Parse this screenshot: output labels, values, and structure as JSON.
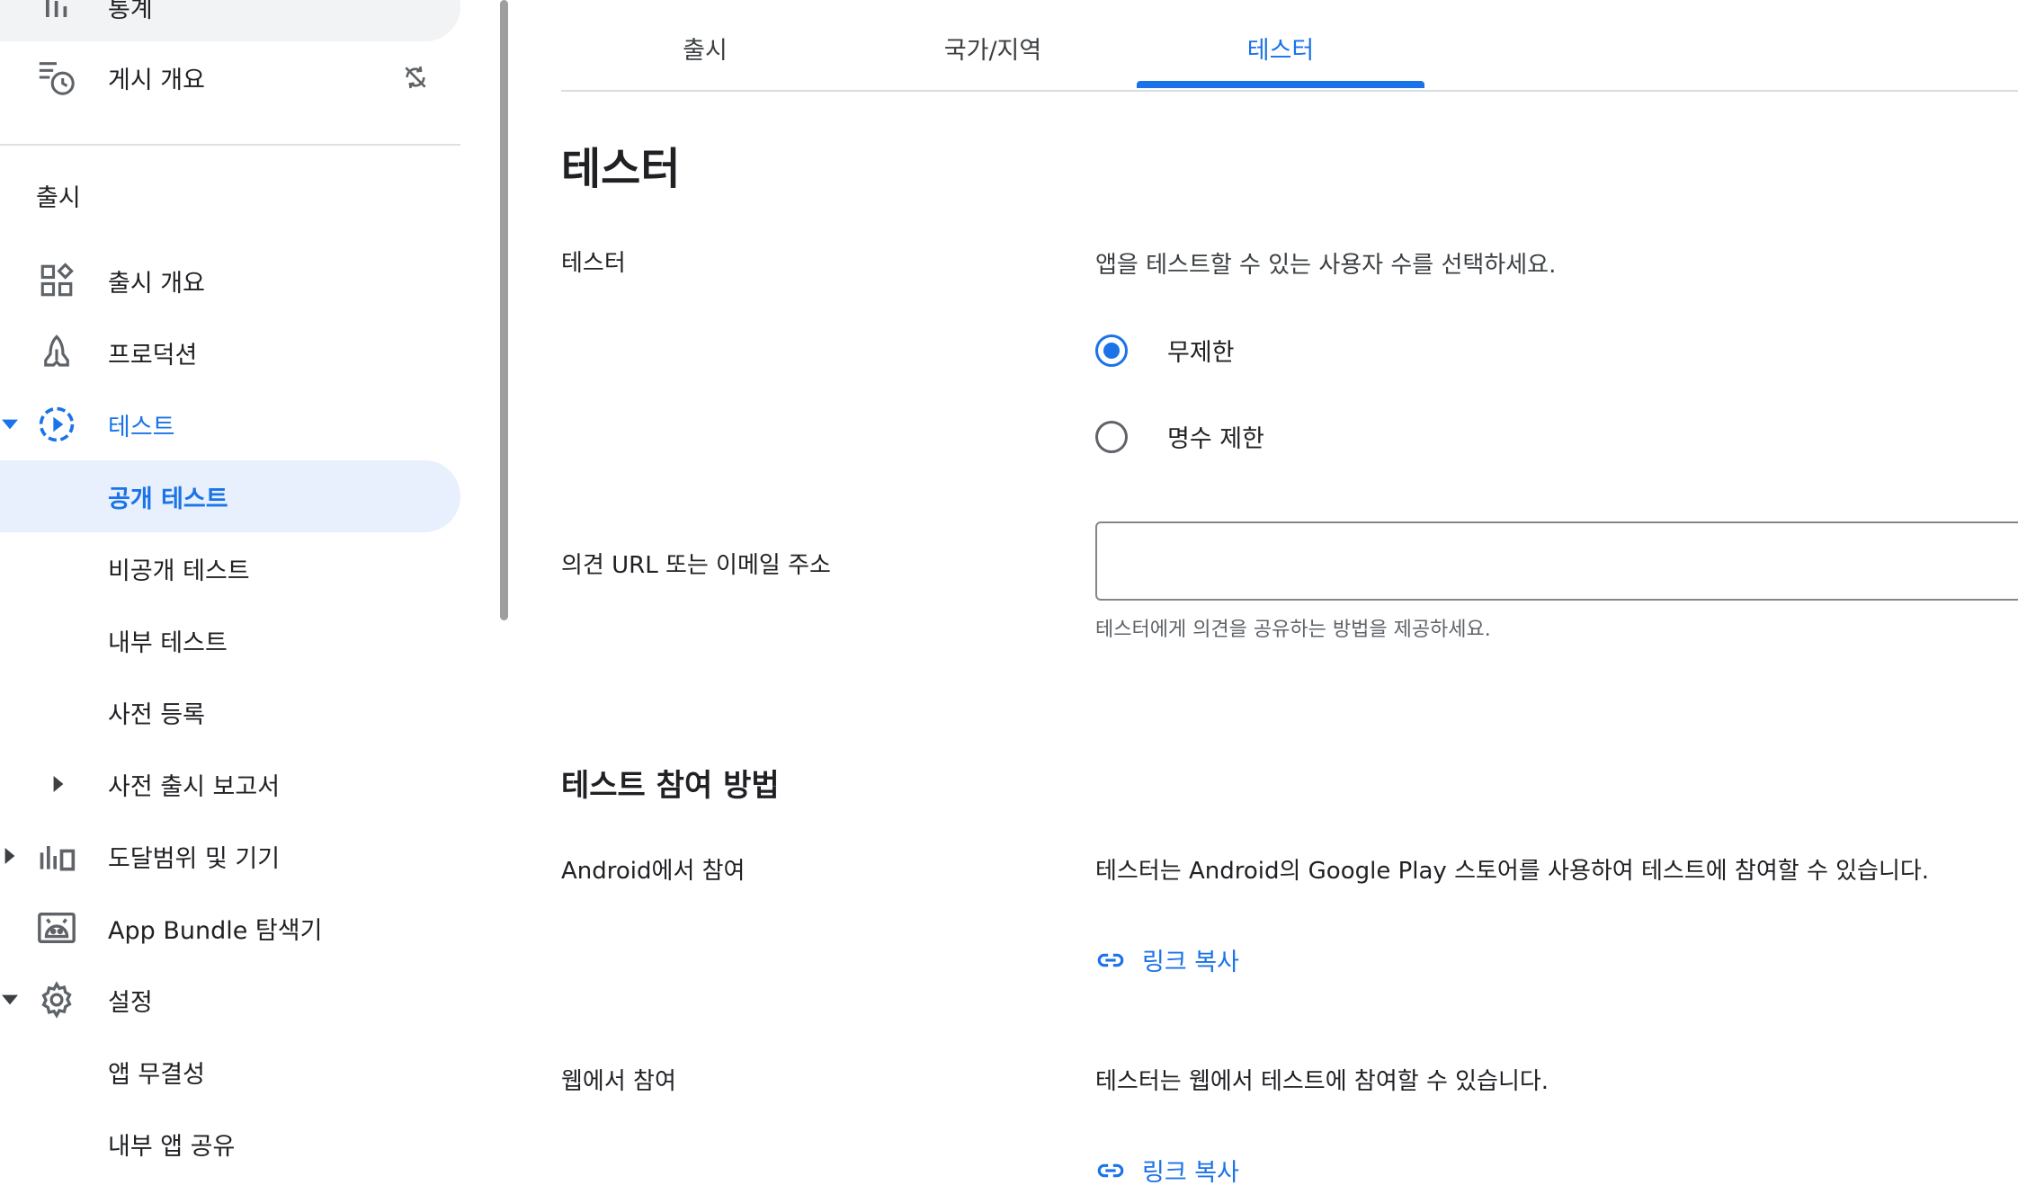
{
  "sidebar": {
    "top_items": [
      {
        "label": "통계",
        "icon": "bar-chart-icon"
      },
      {
        "label": "게시 개요",
        "icon": "publishing-overview-icon",
        "badge_icon": "sync-disabled-icon"
      }
    ],
    "section_heading": "출시",
    "items": [
      {
        "label": "출시 개요",
        "icon": "dashboard-icon"
      },
      {
        "label": "프로덕션",
        "icon": "production-icon"
      },
      {
        "label": "테스트",
        "icon": "testing-play-icon"
      },
      {
        "label": "공개 테스트"
      },
      {
        "label": "비공개 테스트"
      },
      {
        "label": "내부 테스트"
      },
      {
        "label": "사전 등록"
      },
      {
        "label": "사전 출시 보고서"
      },
      {
        "label": "도달범위 및 기기",
        "icon": "reach-devices-icon"
      },
      {
        "label": "App Bundle 탐색기",
        "icon": "android-icon"
      },
      {
        "label": "설정",
        "icon": "gear-icon"
      },
      {
        "label": "앱 무결성"
      },
      {
        "label": "내부 앱 공유"
      }
    ]
  },
  "tabs": [
    {
      "label": "출시"
    },
    {
      "label": "국가/지역"
    },
    {
      "label": "테스터"
    }
  ],
  "main": {
    "title": "테스터",
    "testers": {
      "label": "테스터",
      "description": "앱을 테스트할 수 있는 사용자 수를 선택하세요.",
      "options": [
        {
          "label": "무제한",
          "checked": true
        },
        {
          "label": "명수 제한",
          "checked": false
        }
      ]
    },
    "feedback": {
      "label": "의견 URL 또는 이메일 주소",
      "value": "",
      "placeholder": "",
      "helper": "테스터에게 의견을 공유하는 방법을 제공하세요."
    },
    "join_section": {
      "title": "테스트 참여 방법",
      "android": {
        "label": "Android에서 참여",
        "description": "테스터는 Android의 Google Play 스토어를 사용하여 테스트에 참여할 수 있습니다.",
        "link": "링크 복사"
      },
      "web": {
        "label": "웹에서 참여",
        "description": "테스터는 웹에서 테스트에 참여할 수 있습니다.",
        "link": "링크 복사"
      }
    }
  },
  "colors": {
    "accent": "#1a73e8",
    "selected_bg": "#e8f0fe",
    "text": "#202124",
    "secondary_text": "#5f6368"
  }
}
